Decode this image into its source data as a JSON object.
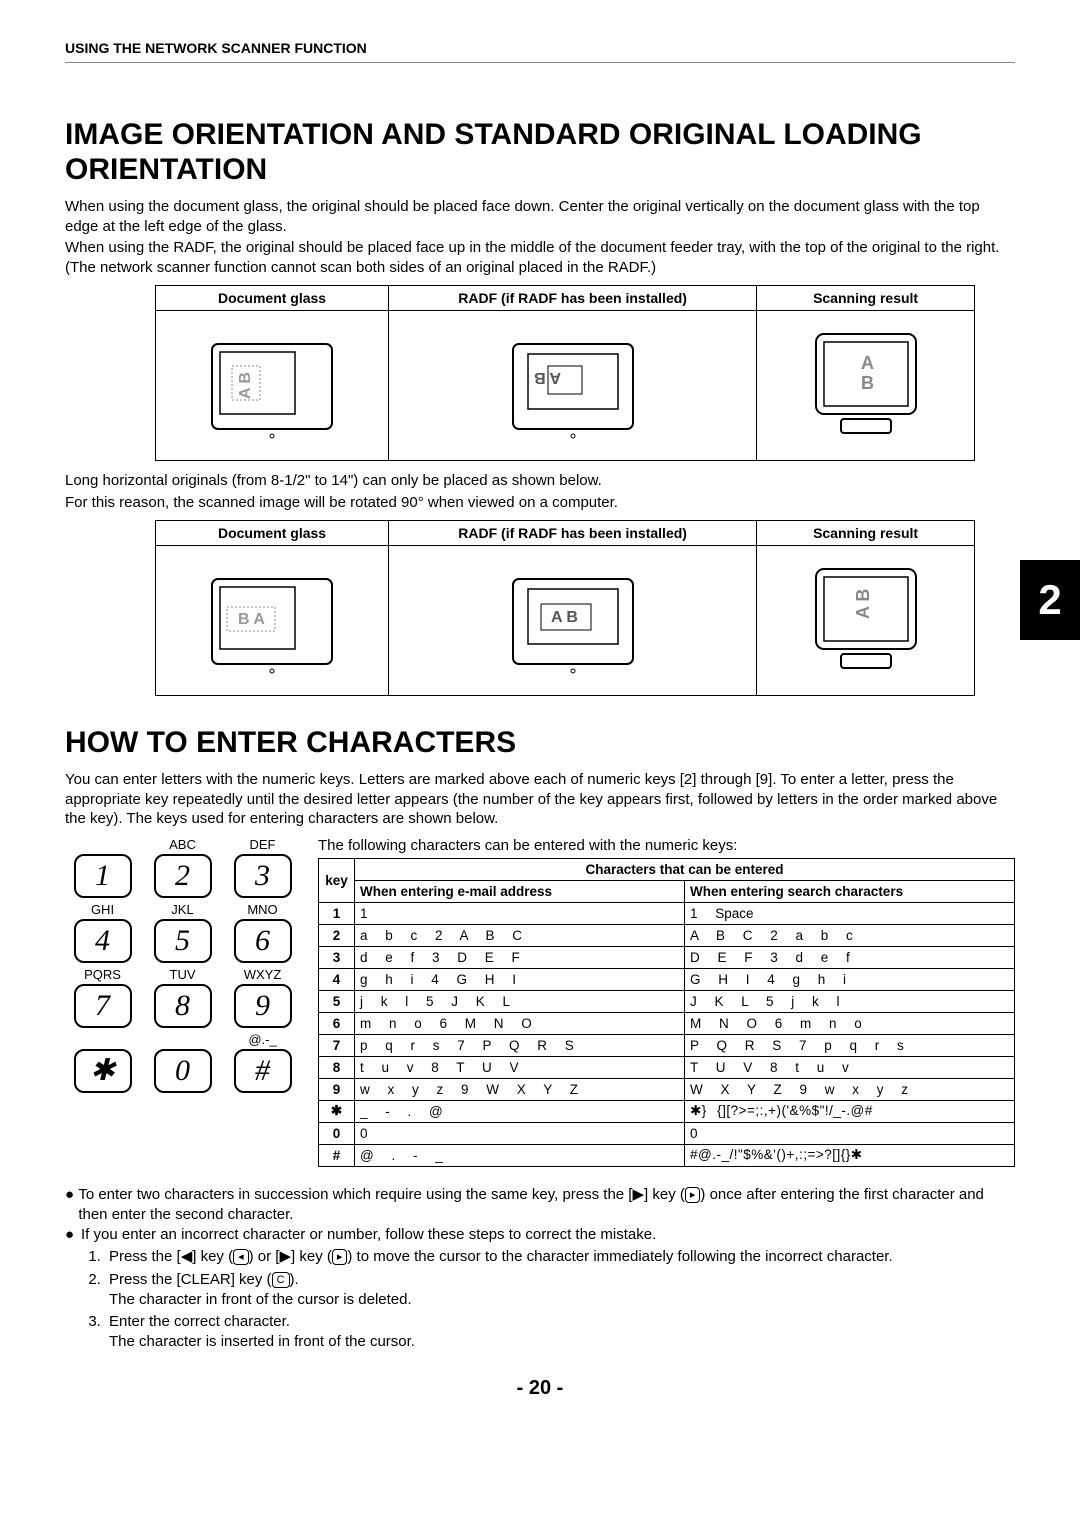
{
  "header": "USING THE NETWORK SCANNER FUNCTION",
  "title1": "IMAGE ORIENTATION AND STANDARD ORIGINAL LOADING ORIENTATION",
  "para1": "When using the document glass, the original should be placed face down. Center the original vertically on the document glass with the top edge at the left edge of the glass.",
  "para2": "When using the RADF, the original should be placed face up in the middle of the document feeder tray, with the top of the original to the right. (The network scanner function cannot scan both sides of an original placed in the RADF.)",
  "orient_headers": {
    "c1": "Document glass",
    "c2": "RADF (if RADF has been installed)",
    "c3": "Scanning result"
  },
  "long_note1": "Long horizontal originals (from 8-1/2\" to 14\") can only be placed as shown below.",
  "long_note2": "For this reason, the scanned image will be rotated 90° when viewed on a computer.",
  "title2": "HOW TO ENTER CHARACTERS",
  "howto_para": "You can enter letters with the numeric keys. Letters are marked above each of numeric keys [2] through [9]. To enter a letter, press the appropriate key repeatedly until the desired letter appears (the number of the key appears first, followed by letters in the order marked above the key). The keys used for entering characters are shown below.",
  "keypad": [
    [
      {
        "label": "",
        "key": "1"
      },
      {
        "label": "ABC",
        "key": "2"
      },
      {
        "label": "DEF",
        "key": "3"
      }
    ],
    [
      {
        "label": "GHI",
        "key": "4"
      },
      {
        "label": "JKL",
        "key": "5"
      },
      {
        "label": "MNO",
        "key": "6"
      }
    ],
    [
      {
        "label": "PQRS",
        "key": "7"
      },
      {
        "label": "TUV",
        "key": "8"
      },
      {
        "label": "WXYZ",
        "key": "9"
      }
    ],
    [
      {
        "label": "",
        "key": "✱"
      },
      {
        "label": "",
        "key": "0"
      },
      {
        "label": "@.-_",
        "key": "#"
      }
    ]
  ],
  "char_caption": "The following characters can be entered with the numeric keys:",
  "char_headers": {
    "main": "Characters that can be entered",
    "key": "key",
    "email": "When entering e-mail address",
    "search": "When entering search characters"
  },
  "char_rows": [
    {
      "k": "1",
      "email": "1",
      "search": "1   Space"
    },
    {
      "k": "2",
      "email": "a   b   c   2   A   B   C",
      "search": "A   B   C   2   a   b   c"
    },
    {
      "k": "3",
      "email": "d   e   f   3   D   E   F",
      "search": "D   E   F   3   d   e   f"
    },
    {
      "k": "4",
      "email": "g   h   i   4   G   H   I",
      "search": "G   H   I   4   g   h   i"
    },
    {
      "k": "5",
      "email": "j   k   l   5   J   K   L",
      "search": "J   K   L   5   j   k   l"
    },
    {
      "k": "6",
      "email": "m   n   o   6   M   N   O",
      "search": "M   N   O   6   m   n   o"
    },
    {
      "k": "7",
      "email": "p   q   r   s   7   P   Q   R   S",
      "search": "P   Q   R   S   7   p   q   r   s"
    },
    {
      "k": "8",
      "email": "t   u   v   8   T   U   V",
      "search": "T   U   V   8   t   u   v"
    },
    {
      "k": "9",
      "email": "w   x   y   z   9   W   X   Y   Z",
      "search": "W   X   Y   Z   9   w   x   y   z"
    },
    {
      "k": "✱",
      "email": "_ - . @",
      "search": "✱} {][?>=;:,+)('&%$\"!/_-.@#"
    },
    {
      "k": "0",
      "email": "0",
      "search": "0"
    },
    {
      "k": "#",
      "email": "@ . - _",
      "search": "#@.-_/!\"$%&'()+,:;=>?[]{}✱"
    }
  ],
  "notes": {
    "n1a": "To enter two characters in succession which require using the same key, press the [",
    "n1b": "] key (",
    "n1c": ") once after entering the first character and then enter the second character.",
    "n2": "If you enter an incorrect character or number, follow these steps to correct the mistake.",
    "s1a": "Press the [",
    "s1b": "] key (",
    "s1c": ") or [",
    "s1d": "] key (",
    "s1e": ") to move the cursor to the character immediately following the incorrect character.",
    "s2a": "Press the [CLEAR] key (",
    "s2b": ").",
    "s2c": "The character in front of the cursor is deleted.",
    "s3a": "Enter the correct character.",
    "s3b": "The character is inserted in front of the cursor."
  },
  "chapter": "2",
  "page": "- 20 -"
}
